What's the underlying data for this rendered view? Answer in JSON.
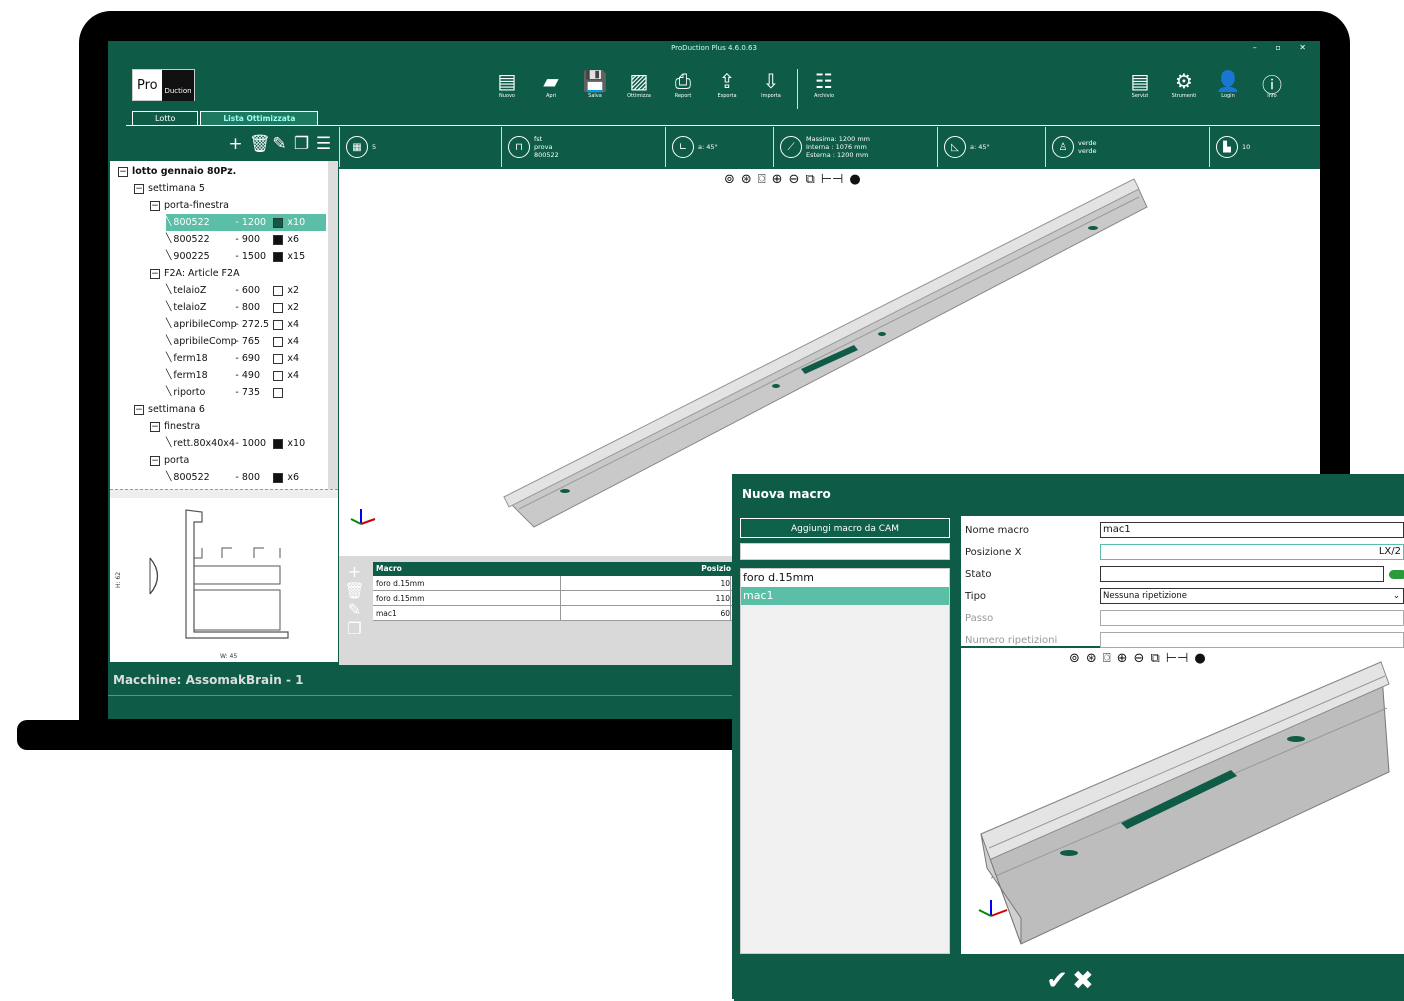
{
  "app": {
    "title": "ProDuction Plus 4.6.0.63",
    "logo_left": "Pro",
    "logo_right": "Duction"
  },
  "toolbar": [
    {
      "label": "Nuovo",
      "icon": "new-file-icon"
    },
    {
      "label": "Apri",
      "icon": "folder-icon"
    },
    {
      "label": "Salva",
      "icon": "save-icon"
    },
    {
      "label": "Ottimizza",
      "icon": "optimize-icon"
    },
    {
      "label": "Report",
      "icon": "printer-icon"
    },
    {
      "label": "Esporta",
      "icon": "export-icon"
    },
    {
      "label": "Importa",
      "icon": "import-icon"
    },
    {
      "label": "Archivio",
      "icon": "archive-icon"
    }
  ],
  "right_tools": [
    {
      "label": "Servizi",
      "icon": "services-icon"
    },
    {
      "label": "Strumenti",
      "icon": "gear-icon"
    },
    {
      "label": "Login",
      "icon": "user-icon"
    },
    {
      "label": "Info",
      "icon": "info-icon"
    }
  ],
  "tabs": {
    "lotto": "Lotto",
    "lista": "Lista Ottimizzata"
  },
  "infobar": {
    "count": "5",
    "profile": [
      "fst",
      "prova",
      "800522"
    ],
    "angle1": "a: 45°",
    "lengths": [
      "Massima: 1200 mm",
      "Interna : 1076 mm",
      "Esterna : 1200 mm"
    ],
    "angle2": "a: 45°",
    "colors": [
      "verde",
      "verde"
    ],
    "pieces": "10"
  },
  "tree": [
    {
      "label": "lotto gennaio 80Pz.",
      "level": 0,
      "expand": "−",
      "bold": true
    },
    {
      "label": "settimana 5",
      "level": 1,
      "expand": "−"
    },
    {
      "label": "porta-finestra",
      "level": 2,
      "expand": "−"
    },
    {
      "label": "800522",
      "len": "- 1200",
      "qty": "x10",
      "level": 3,
      "swatch": "#0e5b47",
      "selected": true
    },
    {
      "label": "800522",
      "len": "- 900",
      "qty": "x6",
      "level": 3,
      "swatch": "#111"
    },
    {
      "label": "900225",
      "len": "- 1500",
      "qty": "x15",
      "level": 3,
      "swatch": "#111"
    },
    {
      "label": "F2A: Article F2A",
      "level": 2,
      "expand": "−"
    },
    {
      "label": "telaioZ",
      "len": "- 600",
      "qty": "x2",
      "level": 3,
      "swatch": "#fff"
    },
    {
      "label": "telaioZ",
      "len": "- 800",
      "qty": "x2",
      "level": 3,
      "swatch": "#fff"
    },
    {
      "label": "apribileComp",
      "len": "- 272.5",
      "qty": "x4",
      "level": 3,
      "swatch": "#fff"
    },
    {
      "label": "apribileComp",
      "len": "- 765",
      "qty": "x4",
      "level": 3,
      "swatch": "#fff"
    },
    {
      "label": "ferm18",
      "len": "- 690",
      "qty": "x4",
      "level": 3,
      "swatch": "#fff"
    },
    {
      "label": "ferm18",
      "len": "- 490",
      "qty": "x4",
      "level": 3,
      "swatch": "#fff"
    },
    {
      "label": "riporto",
      "len": "- 735",
      "qty": "",
      "level": 3,
      "swatch": "#fff"
    },
    {
      "label": "settimana 6",
      "level": 1,
      "expand": "−"
    },
    {
      "label": "finestra",
      "level": 2,
      "expand": "−"
    },
    {
      "label": "rett.80x40x4",
      "len": "- 1000",
      "qty": "x10",
      "level": 3,
      "swatch": "#111"
    },
    {
      "label": "porta",
      "level": 2,
      "expand": "−"
    },
    {
      "label": "800522",
      "len": "- 800",
      "qty": "x6",
      "level": 3,
      "swatch": "#111"
    }
  ],
  "profile_dims": {
    "h": "H: 62",
    "w": "W: 45"
  },
  "grid": {
    "headers": [
      "Macro",
      "Posizio"
    ],
    "rows": [
      [
        "foro d.15mm",
        "10"
      ],
      [
        "foro d.15mm",
        "110"
      ],
      [
        "mac1",
        "60"
      ]
    ]
  },
  "status": "Macchine:  AssomakBrain - 1",
  "dialog": {
    "title": "Nuova macro",
    "add_button": "Aggiungi macro da CAM",
    "list": [
      "foro d.15mm",
      "mac1"
    ],
    "fields": {
      "nome_label": "Nome macro",
      "nome_value": "mac1",
      "posx_label": "Posizione X",
      "posx_value": "LX/2",
      "stato_label": "Stato",
      "tipo_label": "Tipo",
      "tipo_value": "Nessuna ripetizione",
      "passo_label": "Passo",
      "rip_label": "Numero ripetizioni"
    },
    "confirm": "✔",
    "cancel": "✖"
  }
}
